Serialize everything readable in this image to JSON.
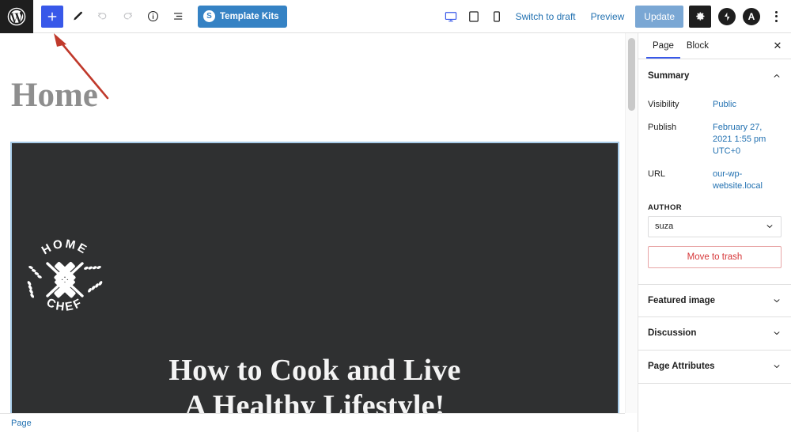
{
  "topbar": {
    "wp_logo": "wordpress-logo",
    "inserter_label": "+",
    "tools_icon": "pencil-icon",
    "undo_icon": "undo-icon",
    "redo_icon": "redo-icon",
    "info_icon": "info-icon",
    "list_view_icon": "list-view-icon",
    "template_kits_label": "Template Kits",
    "template_kits_badge": "S",
    "devices": [
      {
        "name": "desktop",
        "active": true
      },
      {
        "name": "tablet",
        "active": false
      },
      {
        "name": "mobile",
        "active": false
      }
    ],
    "switch_to_draft_label": "Switch to draft",
    "preview_label": "Preview",
    "update_label": "Update",
    "settings_icon": "gear-icon",
    "jetpack_icon": "jetpack-icon",
    "astra_label": "A",
    "more_menu": "kebab-menu-icon",
    "accent_blue": "#3858e9",
    "link_blue": "#2271b1",
    "template_kits_bg": "#3582c4",
    "update_bg": "#7aa7d4"
  },
  "editor": {
    "post_title": "Home",
    "hero": {
      "logo_top_text": "HOME",
      "logo_bottom_text": "CHEF",
      "heading_line1": "How to Cook and Live",
      "heading_line2": "A Healthy Lifestyle!",
      "background_color": "#2f3031",
      "selection_border": "#a7cbe8"
    }
  },
  "sidebar": {
    "tabs": [
      {
        "label": "Page",
        "active": true
      },
      {
        "label": "Block",
        "active": false
      }
    ],
    "close_label": "✕",
    "summary": {
      "title": "Summary",
      "rows": [
        {
          "label": "Visibility",
          "value": "Public"
        },
        {
          "label": "Publish",
          "value": "February 27, 2021 1:55 pm UTC+0"
        },
        {
          "label": "URL",
          "value": "our-wp-website.local"
        }
      ],
      "author_label": "AUTHOR",
      "author_value": "suza"
    },
    "trash_label": "Move to trash",
    "panels": [
      {
        "label": "Featured image"
      },
      {
        "label": "Discussion"
      },
      {
        "label": "Page Attributes"
      }
    ],
    "trash_color": "#d63638"
  },
  "breadcrumb": {
    "items": [
      "Page"
    ]
  }
}
